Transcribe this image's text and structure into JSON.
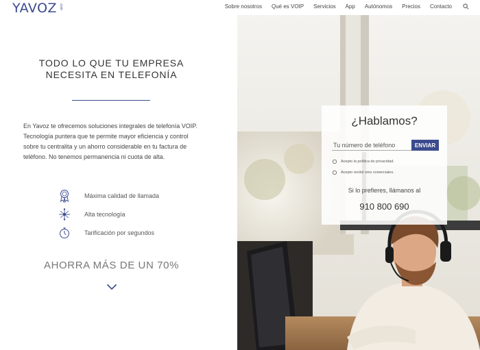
{
  "brand": {
    "logo_text": "YAVOZ",
    "logo_suffix": ".com",
    "accent": "#3b4a8d"
  },
  "nav": {
    "items": [
      {
        "label": "Sobre nosotros"
      },
      {
        "label": "Qué es VOIP"
      },
      {
        "label": "Servicios"
      },
      {
        "label": "App"
      },
      {
        "label": "Autónomos"
      },
      {
        "label": "Precios"
      },
      {
        "label": "Contacto"
      }
    ],
    "search_icon": "search-icon"
  },
  "hero": {
    "headline_line1": "TODO LO QUE TU EMPRESA",
    "headline_line2": "NECESITA EN TELEFONÍA",
    "intro": "En Yavoz te ofrecemos soluciones integrales de telefonía VOIP. Tecnología puntera que te permite mayor eficiencia y control sobre tu centralita y un ahorro considerable en tu factura de teléfono. No tenemos permanencia ni cuota de alta.",
    "features": [
      {
        "icon": "award-ribbon-icon",
        "label": "Máxima calidad de llamada"
      },
      {
        "icon": "network-icon",
        "label": "Alta tecnología"
      },
      {
        "icon": "stopwatch-icon",
        "label": "Tarificación por segundos"
      }
    ],
    "savings": "AHORRA MÁS DE UN 70%",
    "scroll_icon": "chevron-down-icon"
  },
  "contact_card": {
    "title": "¿Hablamos?",
    "phone_placeholder": "Tu número de teléfono",
    "send_label": "ENVIAR",
    "privacy_label": "Acepto la política de privacidad.",
    "commercial_label": "Acepto recibir sms comerciales.",
    "alt_text": "Si lo prefieres, llámanos al",
    "phone_number": "910 800 690"
  }
}
